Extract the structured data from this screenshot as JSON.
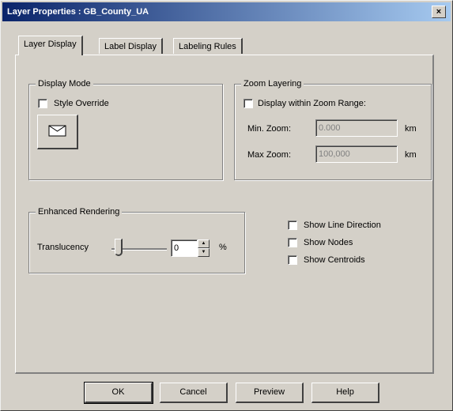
{
  "window": {
    "title": "Layer Properties : GB_County_UA",
    "close_glyph": "×"
  },
  "tabs": [
    {
      "label": "Layer Display",
      "active": true
    },
    {
      "label": "Label Display",
      "active": false
    },
    {
      "label": "Labeling Rules",
      "active": false
    }
  ],
  "display_mode": {
    "legend": "Display Mode",
    "style_override_label": "Style Override",
    "style_override_checked": false,
    "style_button_icon": "envelope-style-icon"
  },
  "zoom_layering": {
    "legend": "Zoom Layering",
    "display_within_label": "Display within Zoom Range:",
    "display_within_checked": false,
    "min_zoom_label": "Min. Zoom:",
    "min_zoom_value": "0.000",
    "max_zoom_label": "Max Zoom:",
    "max_zoom_value": "100,000",
    "unit": "km"
  },
  "enhanced_rendering": {
    "legend": "Enhanced Rendering",
    "translucency_label": "Translucency",
    "translucency_value": "0",
    "unit": "%",
    "slider_position": 0
  },
  "options": {
    "show_line_direction": "Show Line Direction",
    "show_nodes": "Show Nodes",
    "show_centroids": "Show Centroids"
  },
  "buttons": {
    "ok": "OK",
    "cancel": "Cancel",
    "preview": "Preview",
    "help": "Help"
  }
}
